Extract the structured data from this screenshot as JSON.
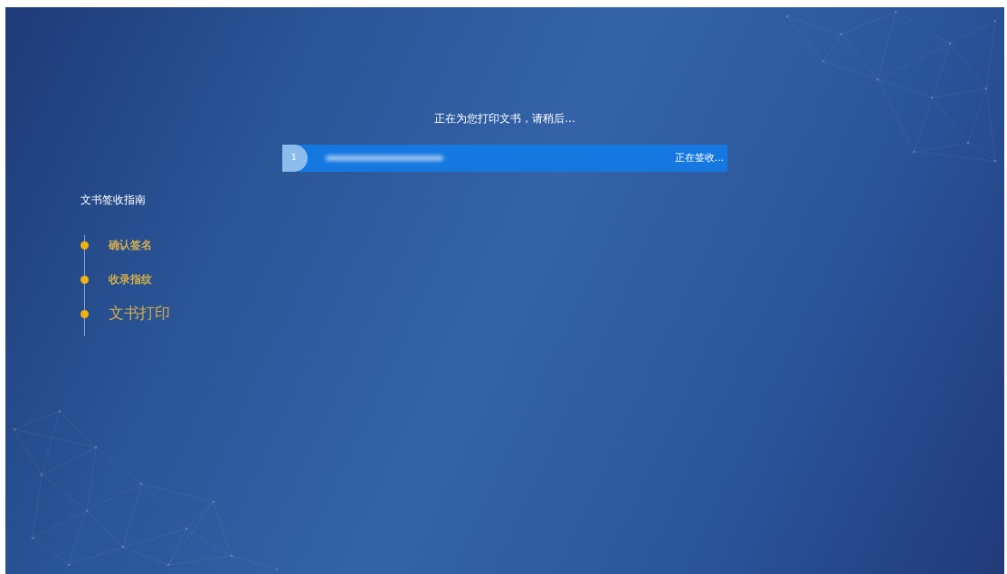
{
  "status_message": "正在为您打印文书，请稍后...",
  "documents": [
    {
      "index": "1",
      "status": "正在签收..."
    }
  ],
  "guide": {
    "title": "文书签收指南",
    "steps": [
      {
        "label": "确认签名",
        "active": false
      },
      {
        "label": "收录指纹",
        "active": false
      },
      {
        "label": "文书打印",
        "active": true
      }
    ]
  }
}
